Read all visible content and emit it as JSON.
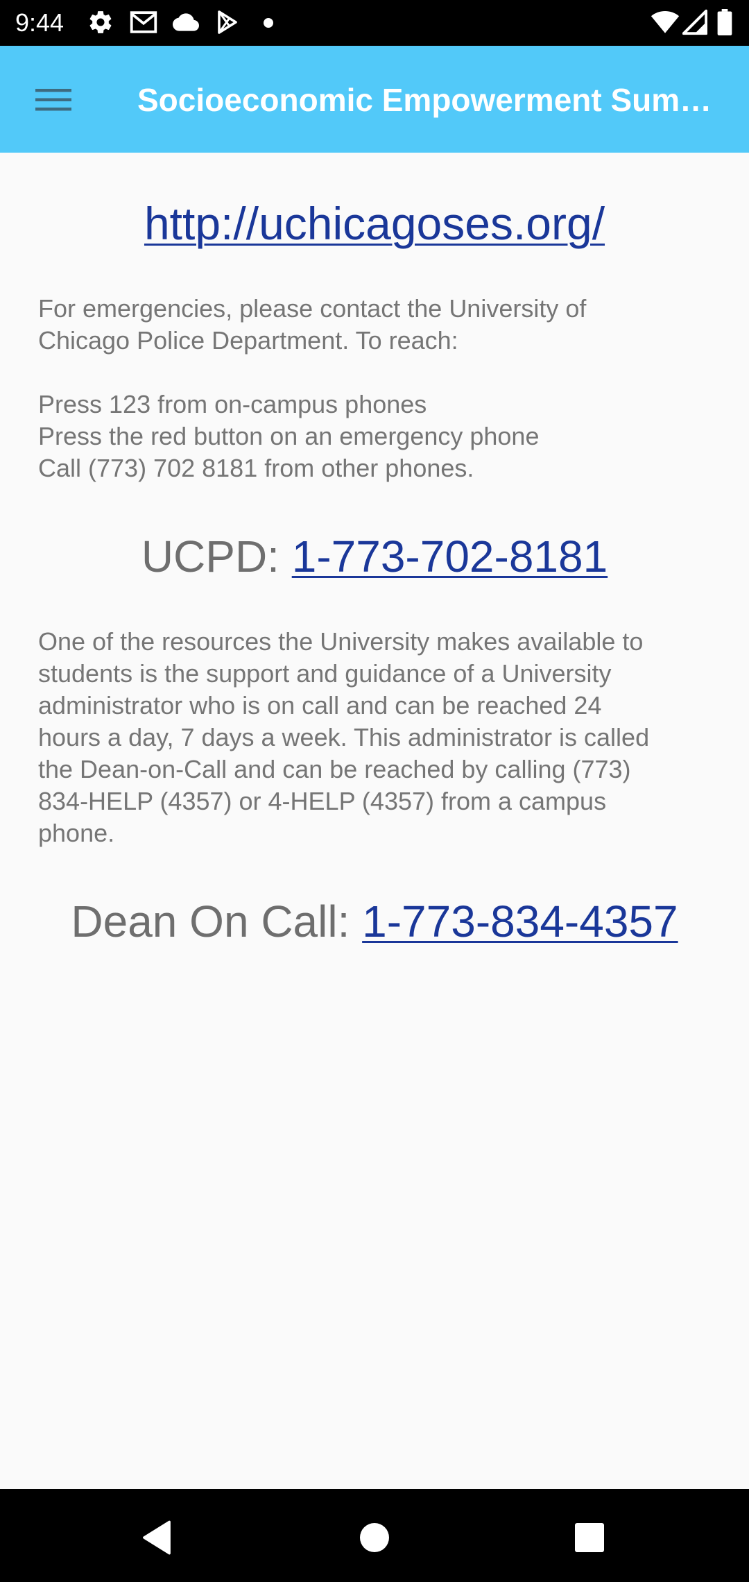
{
  "status_bar": {
    "time": "9:44",
    "left_icons": [
      "gear-icon",
      "gmail-icon",
      "cloud-icon",
      "play-store-icon",
      "dot-icon"
    ],
    "right_icons": [
      "wifi-icon",
      "signal-icon",
      "battery-icon"
    ]
  },
  "app_bar": {
    "title": "Socioeconomic Empowerment Summit",
    "menu_icon": "hamburger-menu-icon",
    "color": "#52c9f9"
  },
  "content": {
    "website_link": "http://uchicagoses.org/",
    "emergency_intro": [
      "For emergencies, please contact the University of",
      "Chicago Police Department. To reach:"
    ],
    "emergency_steps": [
      "Press 123 from on-campus phones",
      "Press the red button on an emergency phone",
      "Call (773) 702 8181 from other phones."
    ],
    "ucpd_label": "UCPD: ",
    "ucpd_phone": "1-773-702-8181",
    "dean_paragraph": [
      "One of the resources the University makes available to",
      "students is the support and guidance of a University",
      "administrator who is on call and can be reached 24",
      "hours a day, 7 days a week. This administrator is called",
      "the Dean-on-Call and can be reached by calling (773)",
      "834-HELP (4357) or 4-HELP (4357) from a campus",
      "phone."
    ],
    "dean_label": "Dean On Call: ",
    "dean_phone": "1-773-834-4357",
    "link_color": "#1a3799",
    "text_color": "#757575"
  },
  "nav_bar": {
    "buttons": [
      "back-icon",
      "home-icon",
      "recents-icon"
    ]
  }
}
